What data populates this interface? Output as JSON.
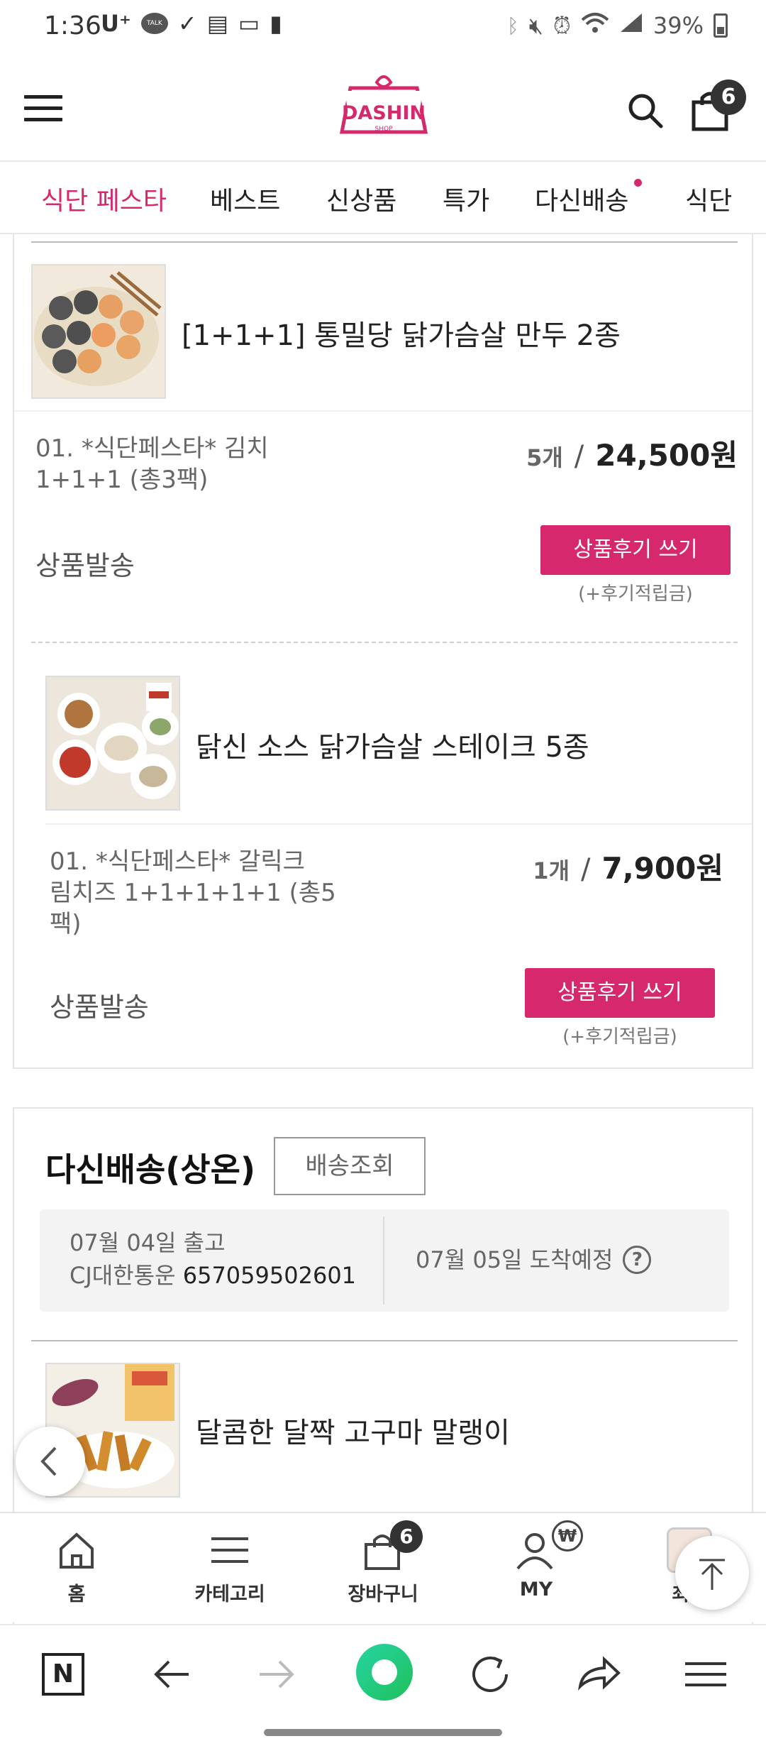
{
  "status_bar": {
    "time": "1:36",
    "carrier": "U⁺",
    "talk_badge": "TALK",
    "battery": "39%"
  },
  "header": {
    "logo_text": "DASHIN",
    "logo_sub": "SHOP",
    "cart_count": "6"
  },
  "categories": [
    {
      "label": "식단 페스타",
      "active": true
    },
    {
      "label": "베스트"
    },
    {
      "label": "신상품"
    },
    {
      "label": "특가"
    },
    {
      "label": "다신배송"
    },
    {
      "label": "식단"
    }
  ],
  "order_items": [
    {
      "product_name": "[1+1+1] 통밀당 닭가슴살 만두 2종",
      "option_line1": "01. *식단페스타* 김치",
      "option_line2": "1+1+1 (총3팩)",
      "qty": "5개",
      "price": "24,500원",
      "status": "상품발송",
      "review_button": "상품후기 쓰기",
      "review_note": "(+후기적립금)"
    },
    {
      "product_name": "닭신 소스 닭가슴살 스테이크 5종",
      "option_line1": "01. *식단페스타* 갈릭크",
      "option_line2": "림치즈 1+1+1+1+1 (총5",
      "option_line3": "팩)",
      "qty": "1개",
      "price": "7,900원",
      "status": "상품발송",
      "review_button": "상품후기 쓰기",
      "review_note": "(+후기적립금)"
    }
  ],
  "delivery": {
    "title": "다신배송(상온)",
    "tracking_button": "배송조회",
    "ship_date": "07월 04일 출고",
    "courier": "CJ대한통운",
    "tracking_number": "657059502601",
    "arrival": "07월 05일 도착예정",
    "help": "?",
    "next_product_name": "달콤한 달짝 고구마 말랭이"
  },
  "tabbar": {
    "home": "홈",
    "category": "카테고리",
    "cart": "장바구니",
    "cart_count": "6",
    "my": "MY",
    "won_badge": "₩",
    "recent": "최근"
  },
  "browser": {
    "n_label": "N"
  },
  "colors": {
    "accent": "#d6286d"
  }
}
